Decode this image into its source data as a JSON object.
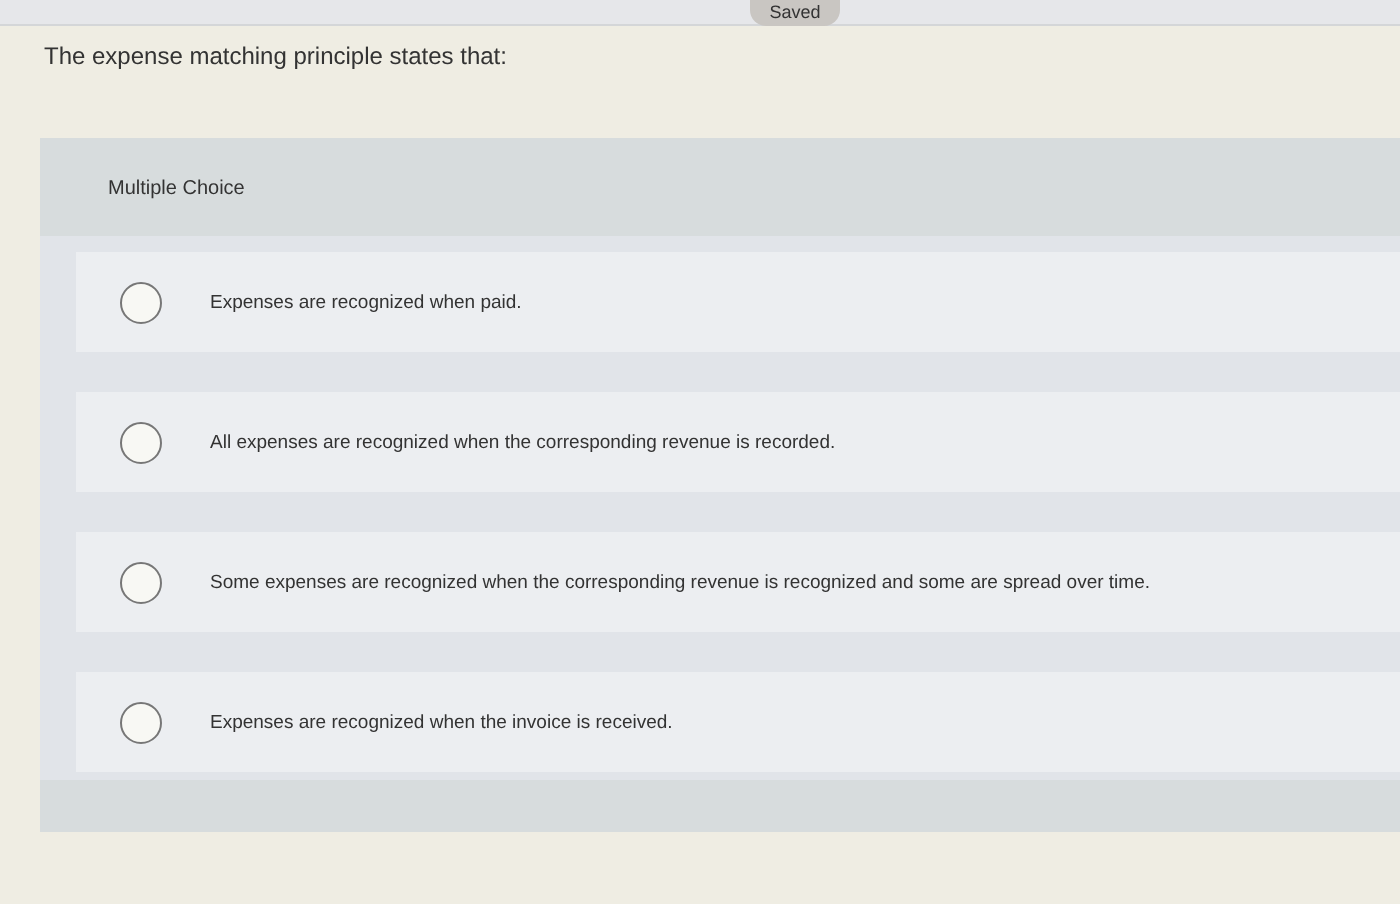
{
  "status_badge": "Saved",
  "question": "The expense matching principle states that:",
  "section_label": "Multiple Choice",
  "options": [
    {
      "text": "Expenses are recognized when paid.",
      "selected": false
    },
    {
      "text": "All expenses are recognized when the corresponding revenue is recorded.",
      "selected": false
    },
    {
      "text": "Some expenses are recognized when the corresponding revenue is recognized and some are spread over time.",
      "selected": false
    },
    {
      "text": "Expenses are recognized when the invoice is received.",
      "selected": false
    }
  ]
}
